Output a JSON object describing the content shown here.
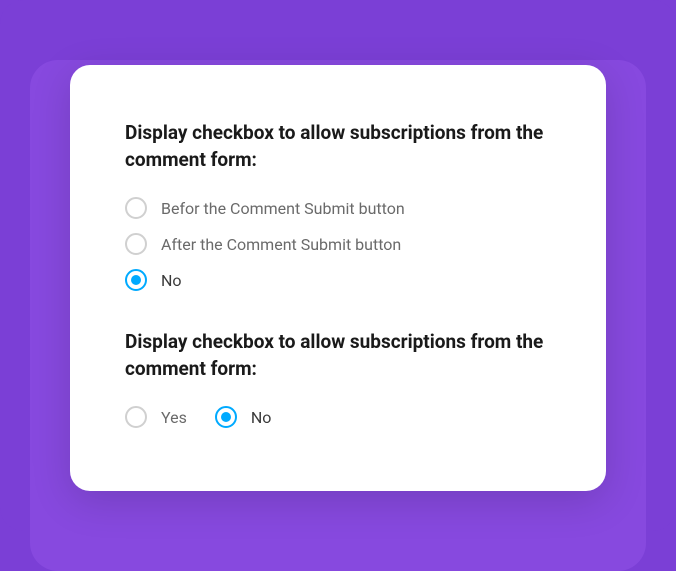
{
  "section1": {
    "title": "Display checkbox to allow subscriptions from the comment form:",
    "options": [
      {
        "label": "Befor the Comment Submit button",
        "selected": false
      },
      {
        "label": "After the Comment Submit button",
        "selected": false
      },
      {
        "label": "No",
        "selected": true
      }
    ]
  },
  "section2": {
    "title": "Display checkbox to allow subscriptions from the comment form:",
    "options": [
      {
        "label": "Yes",
        "selected": false
      },
      {
        "label": "No",
        "selected": true
      }
    ]
  }
}
